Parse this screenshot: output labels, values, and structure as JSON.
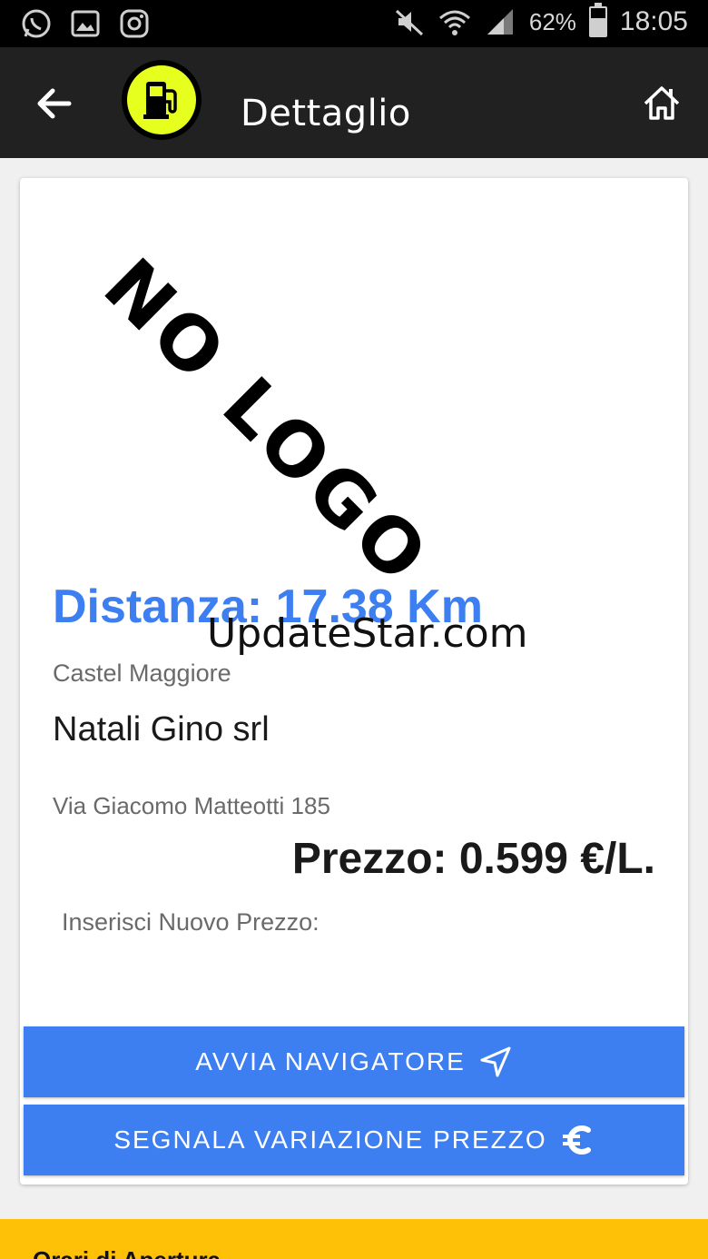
{
  "status_bar": {
    "battery_percent": "62%",
    "battery_level": 0.62,
    "time": "18:05",
    "icons_left": [
      "whatsapp-icon",
      "gallery-icon",
      "instagram-icon"
    ],
    "icons_right": [
      "mute-icon",
      "wifi-icon",
      "signal-icon",
      "battery-icon"
    ]
  },
  "app_bar": {
    "title": "Dettaglio",
    "back_icon": "arrow-back-icon",
    "logo_icon": "fuel-pump-icon",
    "home_icon": "home-icon"
  },
  "station": {
    "logo_placeholder": "NO LOGO",
    "distance": "Distanza: 17.38 Km",
    "city": "Castel Maggiore",
    "name": "Natali Gino srl",
    "address": "Via Giacomo Matteotti 185",
    "price": "Prezzo: 0.599 €/L.",
    "new_price_label": "Inserisci Nuovo Prezzo:"
  },
  "watermark": "UpdateStar.com",
  "buttons": {
    "navigate": "AVVIA NAVIGATORE",
    "report_price": "SEGNALA VARIAZIONE PREZZO"
  },
  "orari": {
    "title": "Orari di Apertura"
  },
  "colors": {
    "accent_blue": "#3d7ff1",
    "appbar": "#212121",
    "logo_yellow": "#e6ff1e",
    "orari_yellow": "#ffc107"
  }
}
